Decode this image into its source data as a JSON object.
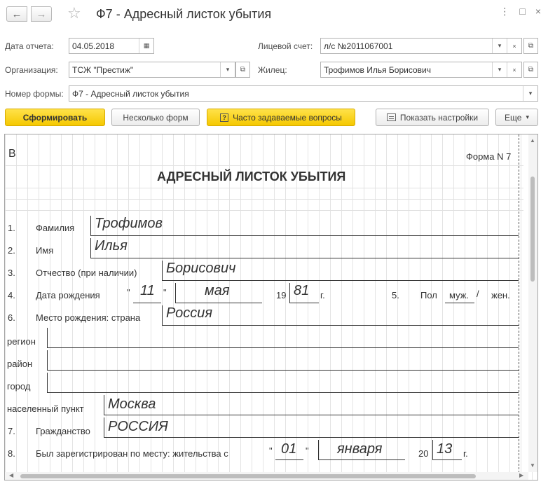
{
  "header": {
    "back_glyph": "←",
    "forward_glyph": "→",
    "favorite_glyph": "☆",
    "title": "Ф7 - Адресный листок убытия",
    "menu_glyph": "⋮",
    "maximize_glyph": "□",
    "close_glyph": "×"
  },
  "form": {
    "report_date_label": "Дата отчета:",
    "report_date_value": "04.05.2018",
    "org_label": "Организация:",
    "org_value": "ТСЖ \"Престиж\"",
    "form_number_label": "Номер формы:",
    "form_number_value": "Ф7 - Адресный листок убытия",
    "account_label": "Лицевой счет:",
    "account_value": "л/с №2011067001",
    "tenant_label": "Жилец:",
    "tenant_value": "Трофимов Илья Борисович",
    "dropdown_glyph": "▾",
    "clear_glyph": "×",
    "open_glyph": "⧉",
    "calendar_glyph": "▦"
  },
  "toolbar": {
    "generate": "Сформировать",
    "several_forms": "Несколько форм",
    "faq_icon": "?",
    "faq": "Часто задаваемые вопросы",
    "show_settings": "Показать настройки",
    "more": "Еще",
    "more_glyph": "▾"
  },
  "doc": {
    "corner_letter": "В",
    "form_no": "Форма N 7",
    "heading": "АДРЕСНЫЙ ЛИСТОК УБЫТИЯ",
    "n1": "1.",
    "surname_label": "Фамилия",
    "surname": "Трофимов",
    "n2": "2.",
    "name_label": "Имя",
    "name": "Илья",
    "n3": "3.",
    "patronymic_label": "Отчество (при наличии)",
    "patronymic": "Борисович",
    "n4": "4.",
    "birth_label": "Дата рождения",
    "quote_open": "\"",
    "birth_day": "11",
    "quote_close": "\"",
    "birth_month": "мая",
    "century": "19",
    "birth_year": "81",
    "year_suffix": "г.",
    "n5": "5.",
    "sex_label": "Пол",
    "sex_male": "муж.",
    "slash": "/",
    "sex_female": "жен.",
    "n6": "6.",
    "birthplace_label": "Место рождения: страна",
    "country": "Россия",
    "region_label": "регион",
    "district_label": "район",
    "city_label": "город",
    "locality_label": "населенный пункт",
    "locality": "Москва",
    "n7": "7.",
    "citizenship_label": "Гражданство",
    "citizenship": "РОССИЯ",
    "n8": "8.",
    "registered_label": "Был зарегистрирован по месту: жительства с",
    "reg_day": "01",
    "reg_month": "января",
    "reg_century": "20",
    "reg_year": "13",
    "reg_suffix": "г."
  },
  "scroll": {
    "up": "▲",
    "down": "▼",
    "left": "◀",
    "right": "▶"
  }
}
